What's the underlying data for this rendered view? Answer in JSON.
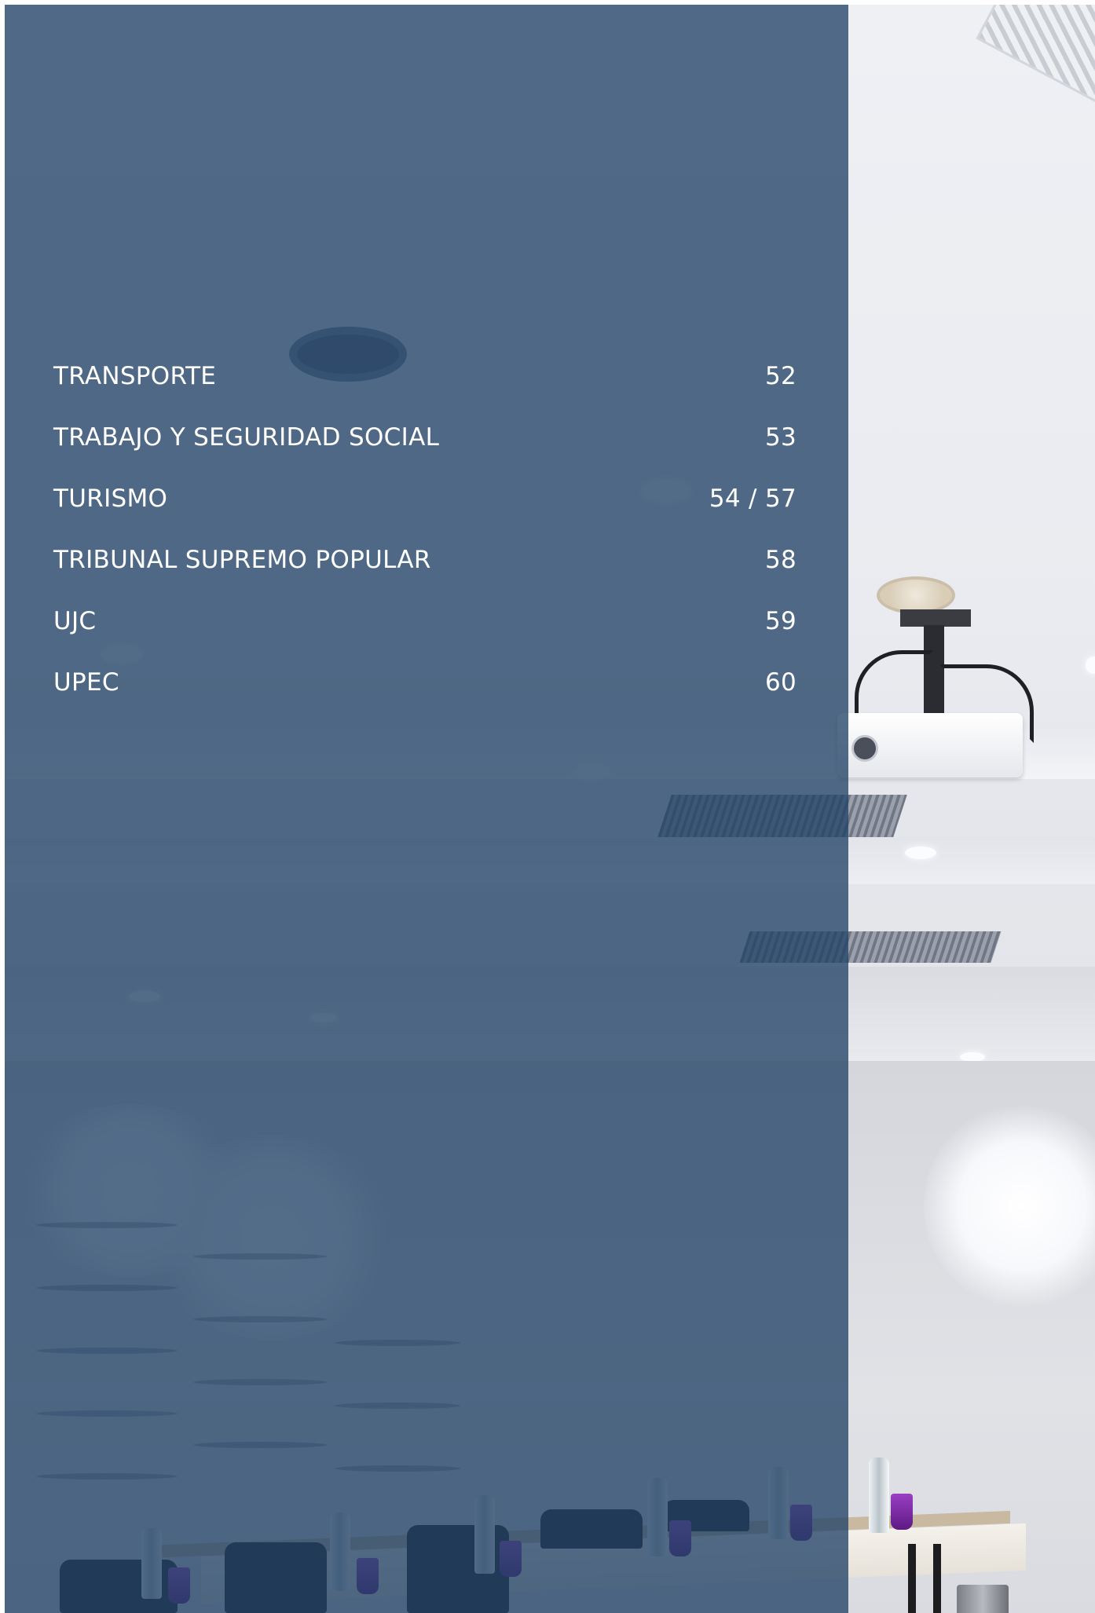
{
  "toc": {
    "items": [
      {
        "title": "TRANSPORTE",
        "page": "52"
      },
      {
        "title": "TRABAJO Y SEGURIDAD SOCIAL",
        "page": "53"
      },
      {
        "title": "TURISMO",
        "page": "54 / 57"
      },
      {
        "title": "TRIBUNAL SUPREMO POPULAR",
        "page": "58"
      },
      {
        "title": "UJC",
        "page": "59"
      },
      {
        "title": "UPEC",
        "page": "60"
      }
    ]
  },
  "colors": {
    "overlay": "#224366",
    "text": "#ffffff",
    "page_background": "#ffffff"
  },
  "background_image": {
    "subject": "conference-room-photo"
  }
}
